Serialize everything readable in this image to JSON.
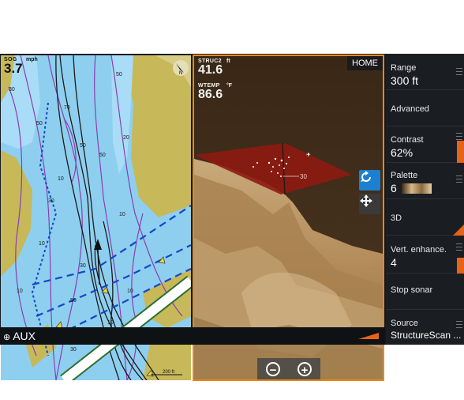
{
  "chart": {
    "sog_label": "SOG",
    "sog_unit": "mph",
    "sog_value": "3.7",
    "scale_text": "200 ft",
    "depth_numbers": [
      "50",
      "30",
      "70",
      "50",
      "20",
      "50",
      "50",
      "10",
      "30",
      "10",
      "10",
      "30",
      "50",
      "10",
      "10",
      "30",
      "10"
    ]
  },
  "sonar": {
    "depth_label": "STRUC2",
    "depth_unit": "ft",
    "depth_value": "41.6",
    "temp_label": "WTEMP",
    "temp_unit": "°F",
    "temp_value": "86.6",
    "home_label": "HOME",
    "fish_depth_label": "30",
    "zoom_out": "−",
    "zoom_in": "+"
  },
  "bottombar": {
    "aux_label": "AUX"
  },
  "menu": {
    "range_title": "Range",
    "range_value": "300 ft",
    "advanced": "Advanced",
    "contrast_title": "Contrast",
    "contrast_value": "62%",
    "contrast_level": 0.62,
    "palette_title": "Palette",
    "palette_value": "6",
    "threed": "3D",
    "vert_title": "Vert. enhance.",
    "vert_value": "4",
    "stop_sonar": "Stop sonar",
    "source_title": "Source",
    "source_value": "StructureScan ..."
  },
  "colors": {
    "accent": "#e8891c",
    "water": "#8ecff0",
    "land": "#c7b85a",
    "contour": "#8a3fb0",
    "active_button": "#1d7fd0"
  }
}
